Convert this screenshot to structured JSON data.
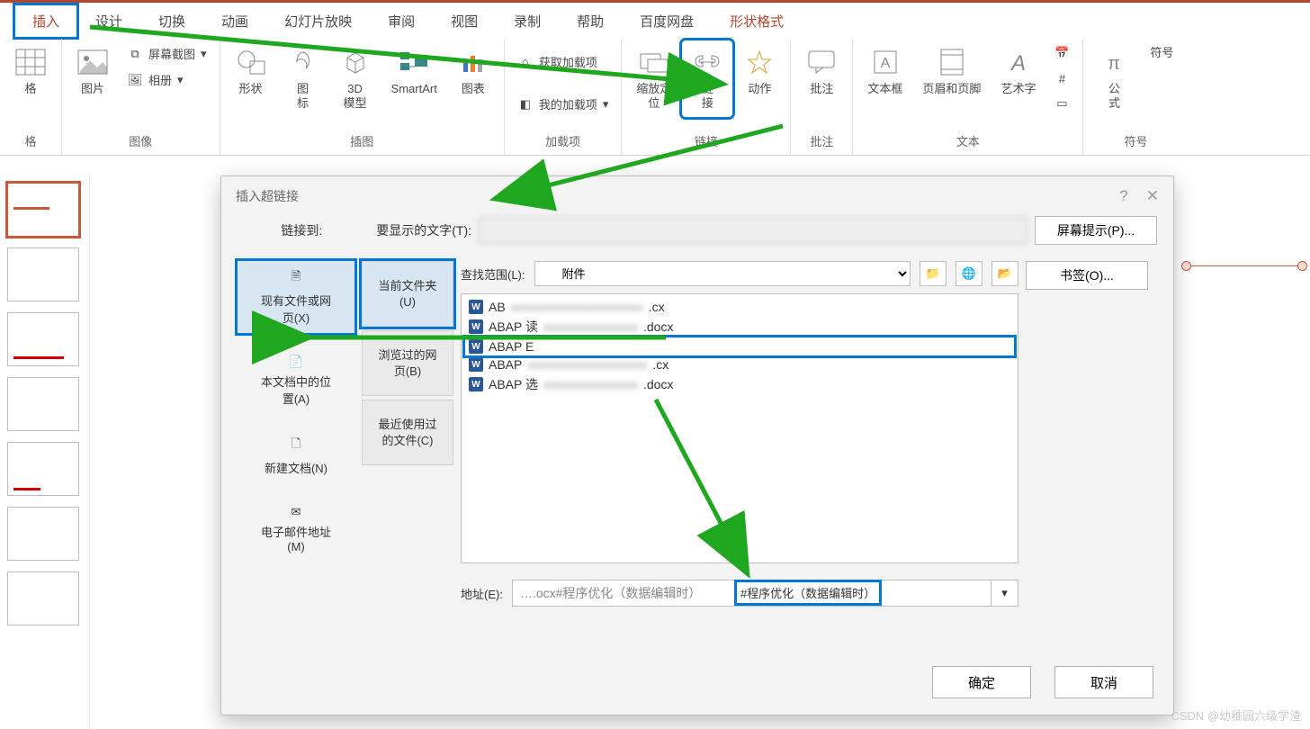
{
  "ribbon_tabs": {
    "insert": "插入",
    "design": "设计",
    "transition": "切换",
    "animate": "动画",
    "slideshow": "幻灯片放映",
    "review": "审阅",
    "view": "视图",
    "record": "录制",
    "help": "帮助",
    "netdisk": "百度网盘",
    "shapefmt": "形状格式"
  },
  "ribbon": {
    "table": "格",
    "image": "图片",
    "screenshot": "屏幕截图",
    "album": "相册",
    "shapes": "形状",
    "icons": "图\n标",
    "model3d": "3D\n模型",
    "smartart": "SmartArt",
    "chart": "图表",
    "getaddin": "获取加载项",
    "myaddin": "我的加载项",
    "zoom": "缩放定\n位",
    "link": "链\n接",
    "action": "动作",
    "comment": "批注",
    "textbox": "文本框",
    "headerfooter": "页眉和页脚",
    "wordart": "艺术字",
    "datetime_ico": "",
    "equation": "公\n式",
    "symbol": "符号",
    "group_table": "格",
    "group_image": "图像",
    "group_illust": "插图",
    "group_addin": "加载项",
    "group_link": "链接",
    "group_comment": "批注",
    "group_text": "文本",
    "group_symbol": "符号"
  },
  "dialog": {
    "title": "插入超链接",
    "link_to": "链接到:",
    "display_text_label": "要显示的文字(T):",
    "screen_tip": "屏幕提示(P)...",
    "look_in_label": "查找范围(L):",
    "look_in_value": "附件",
    "address_label": "地址(E):",
    "address_prefix": ".ocx",
    "address_suffix": "#程序优化（数据编辑时）",
    "bookmark": "书签(O)...",
    "ok": "确定",
    "cancel": "取消",
    "link_types": {
      "existing": "现有文件或网\n页(X)",
      "place": "本文档中的位\n置(A)",
      "newdoc": "新建文档(N)",
      "email": "电子邮件地址\n(M)"
    },
    "scope": {
      "current": "当前文件夹\n(U)",
      "browsed": "浏览过的网\n页(B)",
      "recent": "最近使用过\n的文件(C)"
    },
    "files": [
      {
        "name": "AB",
        "suffix": ".cx"
      },
      {
        "name": "ABAP 读",
        "suffix": ".docx"
      },
      {
        "name": "ABAP E",
        "suffix": ""
      },
      {
        "name": "ABAP",
        "suffix": ".cx"
      },
      {
        "name": "ABAP 选",
        "suffix": ".docx"
      }
    ]
  },
  "watermark": "CSDN @幼稚园六级学渣"
}
